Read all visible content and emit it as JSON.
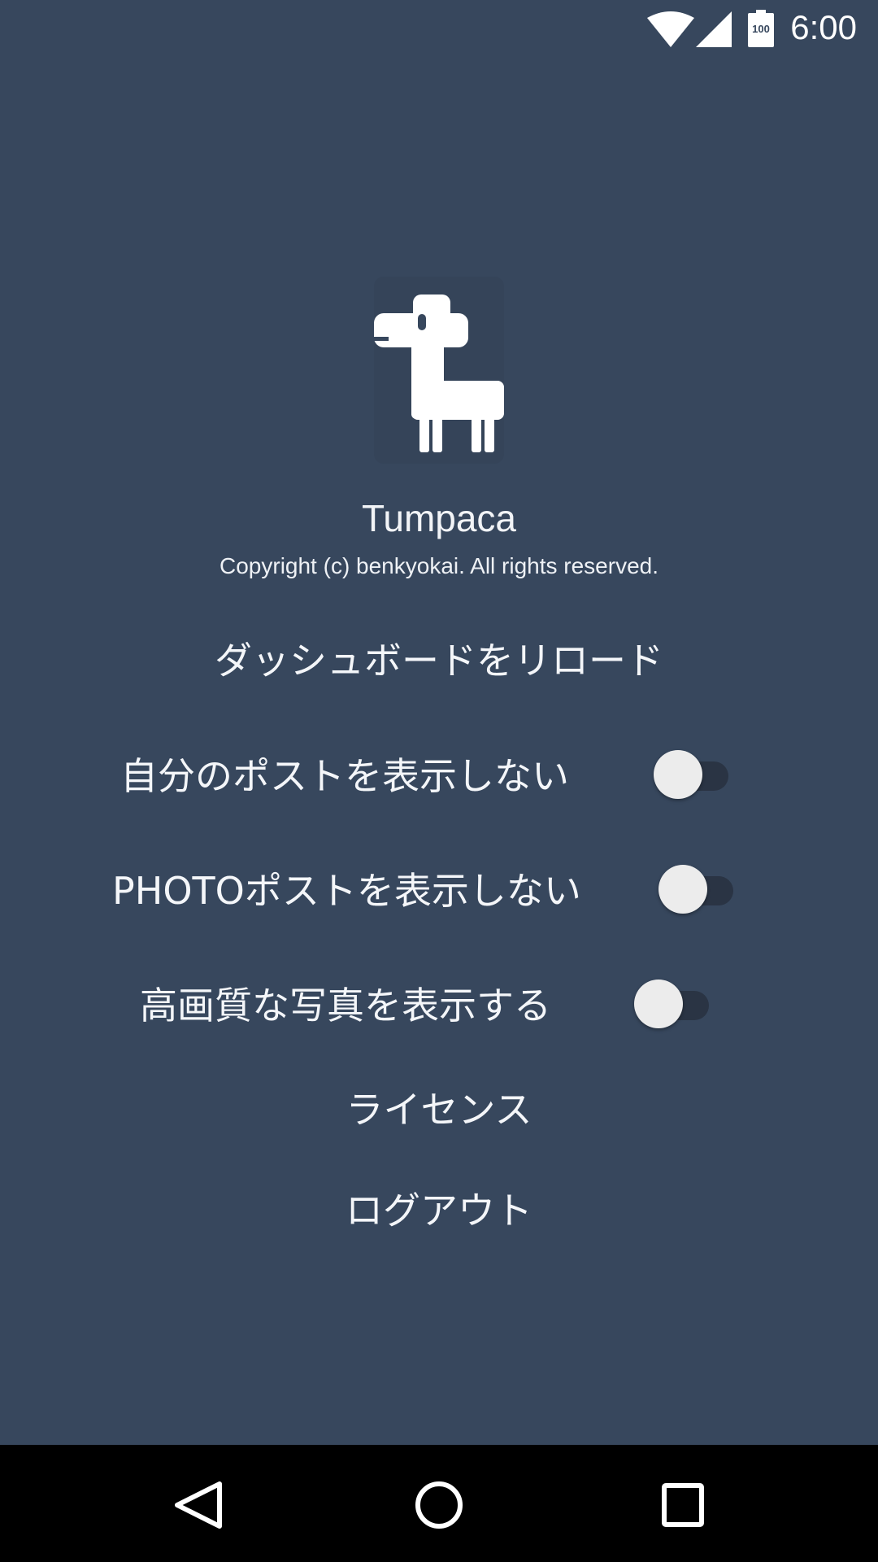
{
  "status_bar": {
    "time": "6:00",
    "battery_level": "100",
    "icons": [
      "wifi-icon",
      "cell-signal-icon",
      "battery-icon"
    ]
  },
  "app": {
    "name": "Tumpaca",
    "copyright": "Copyright (c) benkyokai. All rights reserved.",
    "logo_icon": "llama-logo-icon"
  },
  "menu": {
    "reload_dashboard": "ダッシュボードをリロード",
    "toggles": [
      {
        "label": "自分のポストを表示しない",
        "checked": false
      },
      {
        "label": "PHOTOポストを表示しない",
        "checked": false
      },
      {
        "label": "高画質な写真を表示する",
        "checked": false
      }
    ],
    "license": "ライセンス",
    "logout": "ログアウト"
  },
  "nav_bar": {
    "icons": [
      "back-icon",
      "home-icon",
      "recents-icon"
    ]
  },
  "colors": {
    "background": "#37475d",
    "switch_track": "#2a3444",
    "switch_thumb": "#ececec",
    "nav_bar": "#000000"
  }
}
